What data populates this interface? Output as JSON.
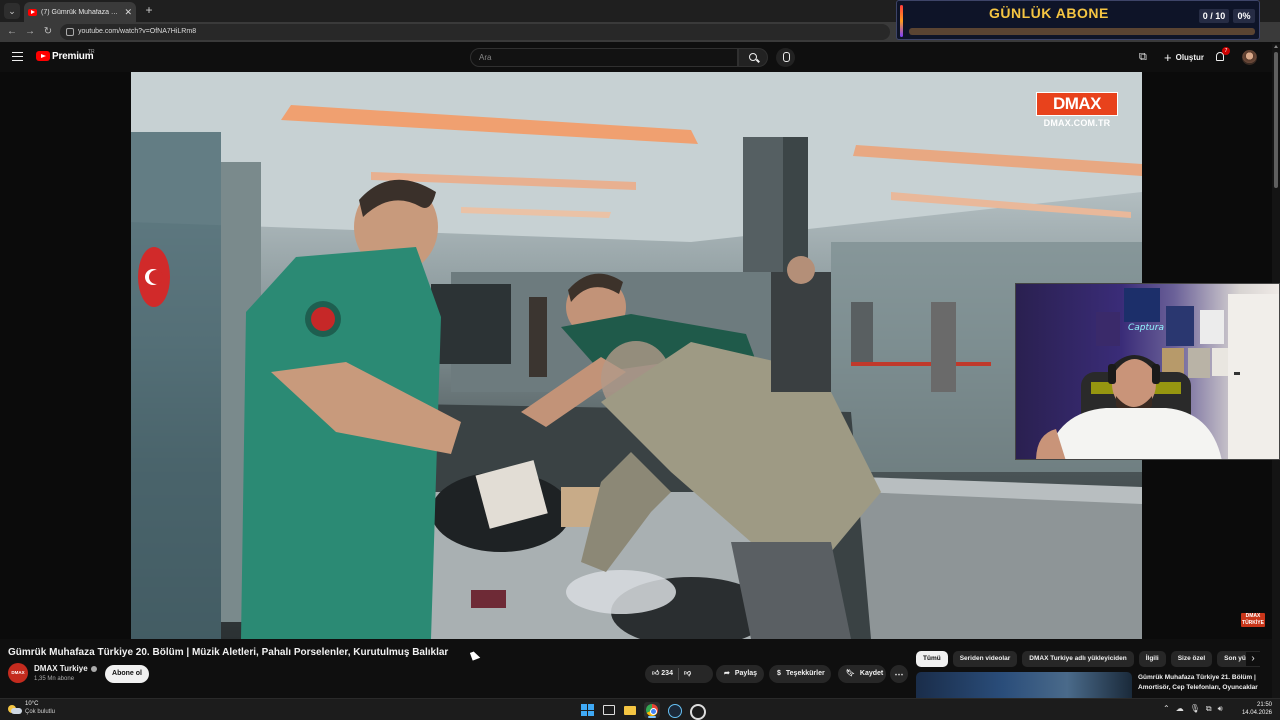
{
  "browser": {
    "tab_title": "(7) Gümrük Muhafaza Türkiye 2...",
    "tab_close": "✕",
    "new_tab": "+",
    "url": "youtube.com/watch?v=OfNA7HiLRm8"
  },
  "sub_widget": {
    "title": "GÜNLÜK ABONE",
    "count": "0 / 10",
    "percent": "0%",
    "progress": 0,
    "colors": {
      "title": "#f5c542",
      "background": "#0e1428"
    }
  },
  "header": {
    "logo_text": "Premium",
    "region": "TR",
    "search_placeholder": "Ara",
    "create_label": "Oluştur",
    "notification_count": "7",
    "icons": [
      "menu-icon",
      "youtube-logo-icon",
      "search-icon",
      "mic-icon",
      "cast-icon",
      "plus-icon",
      "bell-icon",
      "avatar"
    ]
  },
  "video": {
    "watermark_brand": "DMAX",
    "watermark_url": "DMAX.COM.TR",
    "corner_logo": "DMAX",
    "corner_logo_sub": "TÜRKİYE"
  },
  "below": {
    "title": "Gümrük Muhafaza Türkiye 20. Bölüm | Müzik Aletleri, Pahalı Porselenler, Kurutulmuş Balıklar",
    "channel": {
      "avatar_text": "DMAX",
      "name": "DMAX Turkiye",
      "subscribers": "1,35 Mn abone",
      "subscribe_label": "Abone ol"
    },
    "actions": {
      "likes": "234",
      "share": "Paylaş",
      "thanks": "Teşekkürler",
      "save": "Kaydet",
      "more": "⋯"
    }
  },
  "sidebar": {
    "chips": [
      "Tümü",
      "Seriden videolar",
      "DMAX Turkiye adlı yükleyiciden",
      "İlgili",
      "Size özel",
      "Son yüklenenler"
    ],
    "active_chip": 0,
    "next": "›",
    "recommendation_title": "Gümrük Muhafaza Türkiye 21. Bölüm | Amortisör, Cep Telefonları, Oyuncaklar"
  },
  "taskbar": {
    "temperature": "10°C",
    "weather": "Çok bulutlu",
    "time": "21:50",
    "date": "14.04.2026",
    "tray_chevron": "⌃"
  }
}
